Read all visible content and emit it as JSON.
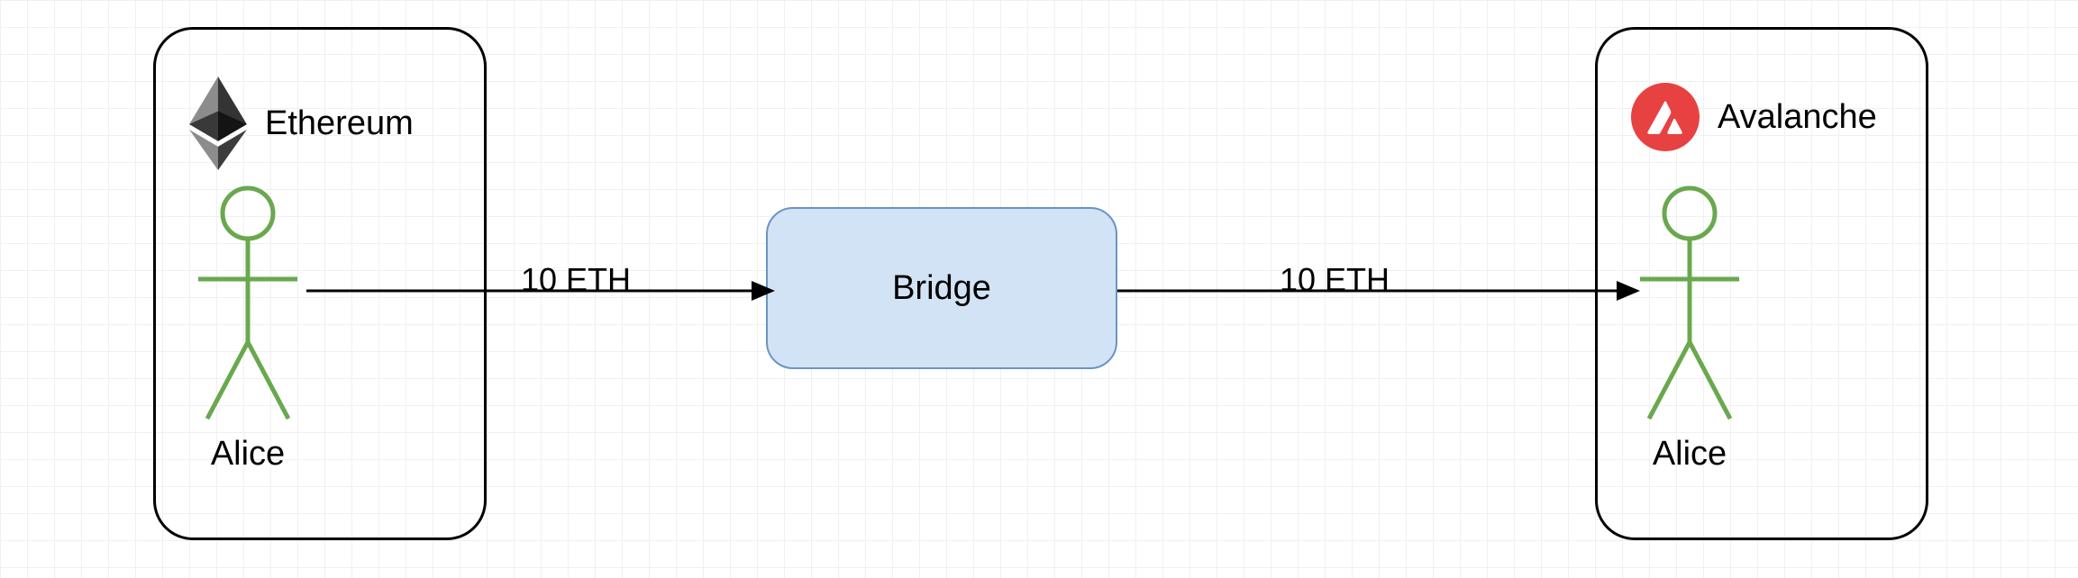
{
  "diagram": {
    "left_chain": {
      "name": "Ethereum",
      "actor": "Alice",
      "icon": "ethereum-icon"
    },
    "right_chain": {
      "name": "Avalanche",
      "actor": "Alice",
      "icon": "avalanche-icon"
    },
    "bridge": {
      "label": "Bridge"
    },
    "edges": {
      "left_to_bridge": "10 ETH",
      "bridge_to_right": "10 ETH"
    }
  },
  "colors": {
    "bridge_fill": "#d3e3f6",
    "bridge_stroke": "#6b94c4",
    "avax_red": "#E84142",
    "actor_green": "#6aa84f"
  }
}
